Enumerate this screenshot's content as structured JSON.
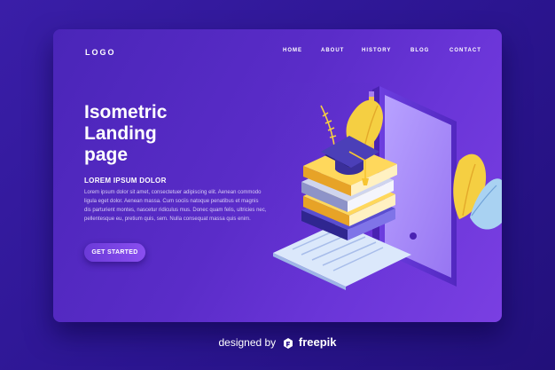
{
  "header": {
    "logo": "LOGO",
    "nav": [
      {
        "label": "HOME"
      },
      {
        "label": "ABOUT"
      },
      {
        "label": "HISTORY"
      },
      {
        "label": "BLOG"
      },
      {
        "label": "CONTACT"
      }
    ]
  },
  "hero": {
    "title_lines": [
      "Isometric",
      "Landing",
      "page"
    ],
    "subheading": "LOREM IPSUM DOLOR",
    "body_lines": [
      "Lorem ipsum dolor sit amet, consectetuer adipiscing elit. Aenean commodo",
      "ligula eget dolor. Aenean massa. Cum sociis natoque penatibus et magnis",
      "dis parturient montes, nascetur ridiculus mus. Donec quam felis, ultricies nec,",
      "pellentesque eu, pretium quis, sem. Nulla consequat massa quis enim."
    ],
    "cta_label": "GET STARTED"
  },
  "footer": {
    "prefix": "designed by",
    "brand": "freepik",
    "brand_icon": "freepik-logo-icon"
  },
  "colors": {
    "page_background": "#2b1590",
    "card_gradient_start": "#4a25b8",
    "card_gradient_end": "#7a3fe2",
    "book_yellow": "#f7c531",
    "book_navy": "#3a2f9a",
    "leaf_yellow": "#f5cf42",
    "leaf_blue": "#a9d2f2"
  }
}
